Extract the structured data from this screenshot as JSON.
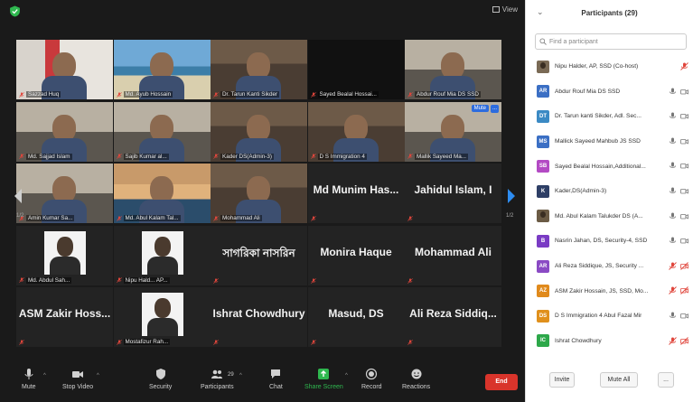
{
  "top": {
    "view_label": "View"
  },
  "tiles": [
    {
      "type": "video",
      "name": "Sazzad Huq",
      "scene": "curtain"
    },
    {
      "type": "video",
      "name": "Md. Ayub Hossain",
      "scene": "beach"
    },
    {
      "type": "video",
      "name": "Dr. Tarun Kanti Sikder",
      "scene": "room"
    },
    {
      "type": "video",
      "name": "Sayed Bealal Hossai...",
      "scene": "dark",
      "active": true
    },
    {
      "type": "video",
      "name": "Abdur Rouf Mia DS SSD",
      "scene": "office"
    },
    {
      "type": "video",
      "name": "Md. Sajjad Islam",
      "scene": "office"
    },
    {
      "type": "video",
      "name": "Sajib Kumar al...",
      "scene": "office"
    },
    {
      "type": "video",
      "name": "Kader DS(Admin-3)",
      "scene": "room"
    },
    {
      "type": "video",
      "name": "D S Immigration 4",
      "scene": "room"
    },
    {
      "type": "video",
      "name": "Mallik Sayeed Ma...",
      "scene": "office",
      "badges": {
        "mute": "Mute",
        "more": "..."
      }
    },
    {
      "type": "video",
      "name": "Amin Kumar Sa...",
      "scene": "office"
    },
    {
      "type": "video",
      "name": "Md. Abul Kalam Tal...",
      "scene": "bridge"
    },
    {
      "type": "video",
      "name": "Mohammad Ali",
      "scene": "room"
    },
    {
      "type": "name",
      "name": "Md Munim Has..."
    },
    {
      "type": "name",
      "name": "Jahidul Islam, I"
    },
    {
      "type": "portrait",
      "name": "Md. Abdul Sah..."
    },
    {
      "type": "portrait",
      "name": "Nipu Hald... AP..."
    },
    {
      "type": "name",
      "name": "সাগরিকা নাসরিন"
    },
    {
      "type": "name",
      "name": "Monira Haque"
    },
    {
      "type": "name",
      "name": "Mohammad Ali"
    },
    {
      "type": "name",
      "name": "ASM Zakir Hoss..."
    },
    {
      "type": "portrait",
      "name": "Mostafizur Rah..."
    },
    {
      "type": "name",
      "name": "Ishrat Chowdhury"
    },
    {
      "type": "name",
      "name": "Masud, DS"
    },
    {
      "type": "name",
      "name": "Ali Reza Siddiq..."
    }
  ],
  "pager": {
    "left": "1/2",
    "right": "1/2"
  },
  "toolbar": {
    "mute": "Mute",
    "stop_video": "Stop Video",
    "security": "Security",
    "participants": "Participants",
    "participants_count": "29",
    "chat": "Chat",
    "share_screen": "Share Screen",
    "record": "Record",
    "reactions": "Reactions",
    "end": "End"
  },
  "panel": {
    "title": "Participants (29)",
    "search_placeholder": "Find a participant",
    "participants": [
      {
        "initials": "",
        "photo": true,
        "name": "Nipu Halder, AP, SSD (Co-host)",
        "color": "#7a6a55",
        "mic": "muted",
        "video": "none"
      },
      {
        "initials": "AR",
        "name": "Abdur Rouf Mia DS SSD",
        "color": "#3b6fc4",
        "mic": "on",
        "video": "on"
      },
      {
        "initials": "DT",
        "name": "Dr. Tarun kanti Sikder, Adl. Sec...",
        "color": "#3b8ac4",
        "mic": "on",
        "video": "on"
      },
      {
        "initials": "MS",
        "name": "Mallick Sayeed Mahbub JS SSD",
        "color": "#3b6fc4",
        "mic": "on",
        "video": "on"
      },
      {
        "initials": "SB",
        "name": "Sayed Bealal Hossain,Additional...",
        "color": "#b34ac4",
        "mic": "on",
        "video": "on"
      },
      {
        "initials": "K",
        "name": "Kader,DS(Admin-3)",
        "color": "#2e3f66",
        "mic": "on",
        "video": "on"
      },
      {
        "initials": "",
        "photo": true,
        "name": "Md. Abul Kalam Talukder DS (A...",
        "color": "#6b5b45",
        "mic": "on",
        "video": "on"
      },
      {
        "initials": "B",
        "name": "Nasrin Jahan, DS, Security-4, SSD",
        "color": "#7a3cc4",
        "mic": "on",
        "video": "on"
      },
      {
        "initials": "AR",
        "name": "Ali Reza Siddique, JS, Security ...",
        "color": "#8a4ac4",
        "mic": "muted",
        "video": "off"
      },
      {
        "initials": "AZ",
        "name": "ASM Zakir Hossain, JS, SSD, Mo...",
        "color": "#e08a1c",
        "mic": "muted",
        "video": "off"
      },
      {
        "initials": "DS",
        "name": "D S Immigration 4 Abul Fazal Mir",
        "color": "#e0901c",
        "mic": "on",
        "video": "on"
      },
      {
        "initials": "IC",
        "name": "Ishrat Chowdhury",
        "color": "#2da84a",
        "mic": "muted",
        "video": "off"
      }
    ],
    "invite": "Invite",
    "mute_all": "Mute All",
    "more": "..."
  },
  "colors": {
    "accent": "#2d6cdf",
    "end": "#d9342b",
    "share": "#2fb84f",
    "muted": "#e0463c",
    "active_border": "#e6e26a"
  }
}
